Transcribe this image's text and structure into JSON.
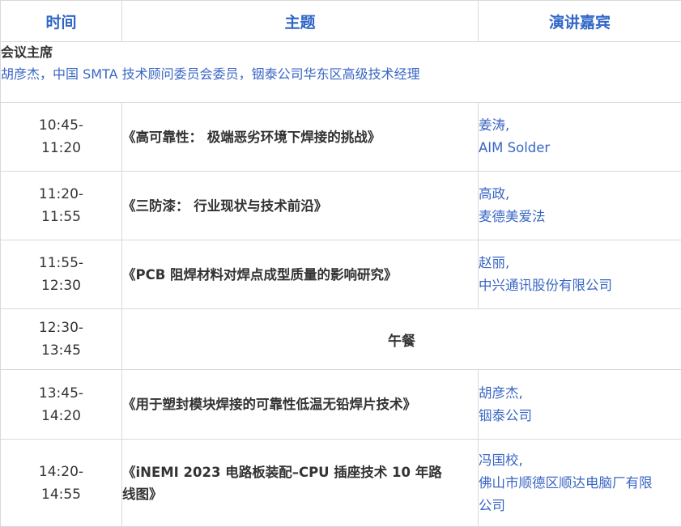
{
  "header": {
    "time": "时间",
    "topic": "主题",
    "speaker": "演讲嘉宾"
  },
  "chair": {
    "title": "会议主席",
    "description": "胡彦杰，中国 SMTA 技术顾问委员会委员，铟泰公司华东区高级技术经理"
  },
  "sessions": [
    {
      "start": "10:45-",
      "end": "11:20",
      "topic": "《高可靠性： 极端恶劣环境下焊接的挑战》",
      "speaker_name": "姜涛,",
      "speaker_org": "AIM Solder"
    },
    {
      "start": "11:20-",
      "end": "11:55",
      "topic": "《三防漆： 行业现状与技术前沿》",
      "speaker_name": "高政,",
      "speaker_org": "麦德美爱法"
    },
    {
      "start": "11:55-",
      "end": "12:30",
      "topic": "《PCB 阻焊材料对焊点成型质量的影响研究》",
      "speaker_name": "赵丽,",
      "speaker_org": "中兴通讯股份有限公司"
    },
    {
      "start": "12:30-",
      "end": "13:45",
      "lunch": "午餐"
    },
    {
      "start": "13:45-",
      "end": "14:20",
      "topic": "《用于塑封模块焊接的可靠性低温无铅焊片技术》",
      "speaker_name": "胡彦杰,",
      "speaker_org": "铟泰公司"
    },
    {
      "start": "14:20-",
      "end": "14:55",
      "topic_line1": "《iNEMI 2023 电路板装配–CPU 插座技术 10 年路",
      "topic_line2": "线图》",
      "speaker_name": "冯国校,",
      "speaker_org_line1": "佛山市顺德区顺达电脑厂有限",
      "speaker_org_line2": "公司"
    }
  ]
}
